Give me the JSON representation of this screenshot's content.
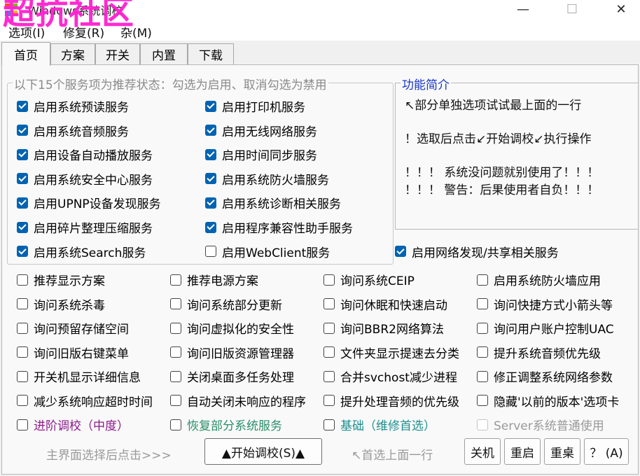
{
  "window": {
    "title": "Windows系统调校",
    "watermark": "超抗社区",
    "controls": {
      "minimize": "—",
      "maximize": "☐",
      "close": "✕"
    }
  },
  "menu": [
    "选项(I)",
    "修复(R)",
    "杂(M)"
  ],
  "tabs": [
    "首页",
    "方案",
    "开关",
    "内置",
    "下载"
  ],
  "services_group": {
    "legend": "以下15个服务项为推荐状态：勾选为启用、取消勾选为禁用",
    "items": [
      {
        "label": "启用系统预读服务",
        "checked": true
      },
      {
        "label": "启用打印机服务",
        "checked": true
      },
      {
        "label": "启用系统音频服务",
        "checked": true
      },
      {
        "label": "启用无线网络服务",
        "checked": true
      },
      {
        "label": "启用设备自动播放服务",
        "checked": true
      },
      {
        "label": "启用时间同步服务",
        "checked": true
      },
      {
        "label": "启用系统安全中心服务",
        "checked": true
      },
      {
        "label": "启用系统防火墙服务",
        "checked": true
      },
      {
        "label": "启用UPNP设备发现服务",
        "checked": true
      },
      {
        "label": "启用系统诊断相关服务",
        "checked": true
      },
      {
        "label": "启用碎片整理压缩服务",
        "checked": true
      },
      {
        "label": "启用程序兼容性助手服务",
        "checked": true
      },
      {
        "label": "启用系统Search服务",
        "checked": true
      },
      {
        "label": "启用WebClient服务",
        "checked": false
      },
      {
        "label": "启用网络发现/共享相关服务",
        "checked": true
      }
    ]
  },
  "info": {
    "legend": "功能简介",
    "lines": [
      "↖部分单独选项试试最上面的一行",
      "！选取后点击↙开始调校↙执行操作",
      "！！！ 系统没问题就别使用了！！！",
      "！！！ 警告：后果使用者自负！！！"
    ]
  },
  "options": [
    {
      "label": "推荐显示方案",
      "checked": false
    },
    {
      "label": "推荐电源方案",
      "checked": false
    },
    {
      "label": "询问系统CEIP",
      "checked": false
    },
    {
      "label": "启用系统防火墙应用",
      "checked": false
    },
    {
      "label": "询问系统杀毒",
      "checked": false
    },
    {
      "label": "询问系统部分更新",
      "checked": false
    },
    {
      "label": "询问休眠和快速启动",
      "checked": false
    },
    {
      "label": "询问快捷方式小箭头等",
      "checked": false
    },
    {
      "label": "询问预留存储空间",
      "checked": false
    },
    {
      "label": "询问虚拟化的安全性",
      "checked": false
    },
    {
      "label": "询问BBR2网络算法",
      "checked": false
    },
    {
      "label": "询问用户账户控制UAC",
      "checked": false
    },
    {
      "label": "询问旧版右键菜单",
      "checked": false
    },
    {
      "label": "询问旧版资源管理器",
      "checked": false
    },
    {
      "label": "文件夹显示提速去分类",
      "checked": false
    },
    {
      "label": "提升系统音频优先级",
      "checked": false
    },
    {
      "label": "开关机显示详细信息",
      "checked": false
    },
    {
      "label": "关闭桌面多任务处理",
      "checked": false
    },
    {
      "label": "合并svchost减少进程",
      "checked": false
    },
    {
      "label": "修正调整系统网络参数",
      "checked": false
    },
    {
      "label": "减少系统响应超时时间",
      "checked": false
    },
    {
      "label": "自动关闭未响应的程序",
      "checked": false
    },
    {
      "label": "提升处理音频的优先级",
      "checked": false
    },
    {
      "label": "隐藏'以前的版本'选项卡",
      "checked": false
    }
  ],
  "presets": [
    {
      "label": "进阶调校（中度）",
      "color": "#8b1a8b"
    },
    {
      "label": "恢复部分系统服务",
      "color": "#2a8f6a"
    },
    {
      "label": "基础（维修首选）",
      "color": "#1f8f8f"
    },
    {
      "label": "Server系统普通使用",
      "color": "#9a9a9a"
    }
  ],
  "footer": {
    "hint_left": "主界面选择后点击>>>",
    "start_button": "▲开始调校(S)▲",
    "hint_right": "↖首选上面一行",
    "shutdown": "关机",
    "restart": "重启",
    "reload_desktop": "重桌",
    "help": "？ (A)"
  },
  "colors": {
    "accent": "#0063b1",
    "watermark": "#ff1fd0",
    "info_legend": "#1a37c8"
  }
}
